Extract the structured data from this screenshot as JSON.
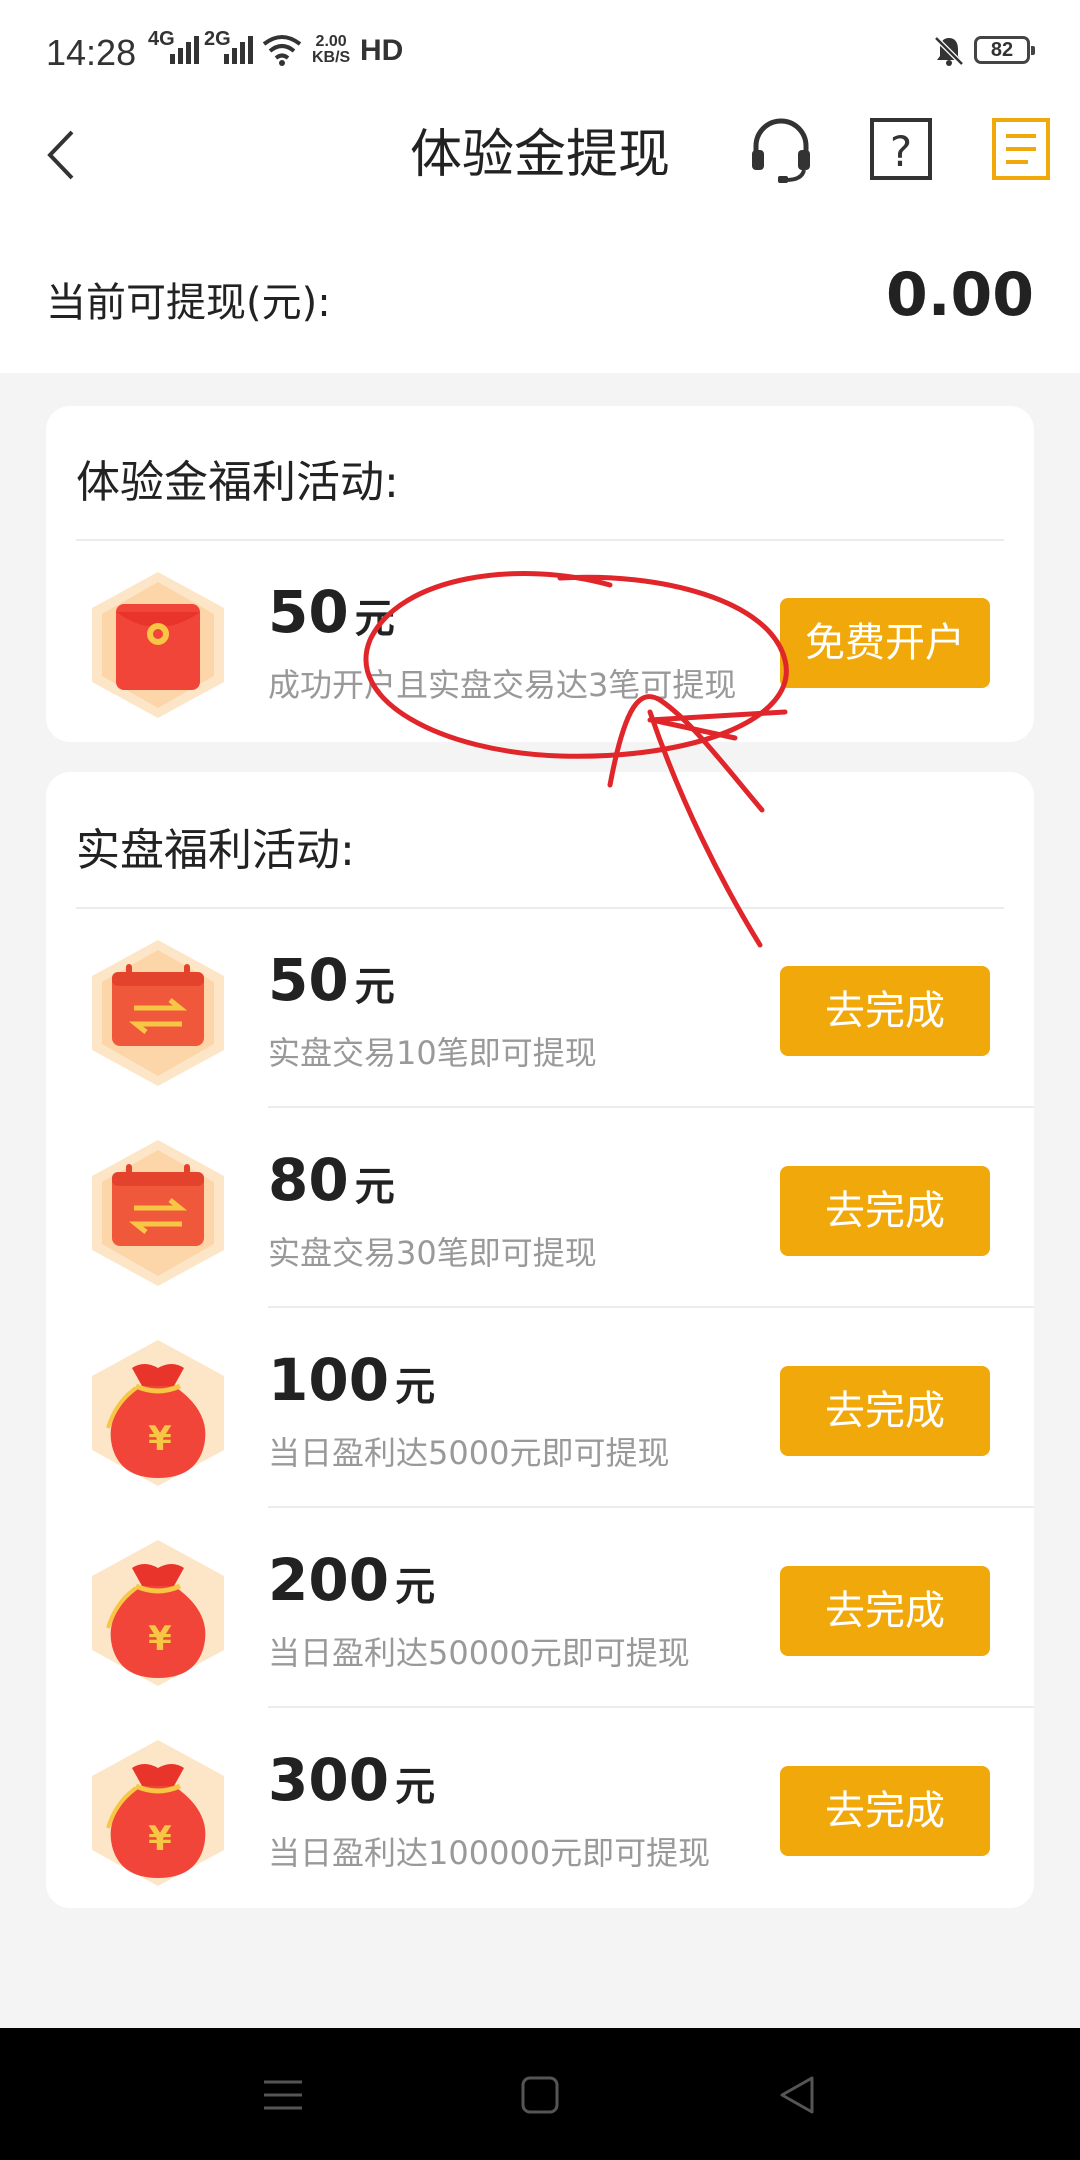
{
  "status_bar": {
    "time": "14:28",
    "net1": "4G",
    "net2": "2G",
    "speed_value": "2.00",
    "speed_unit": "KB/S",
    "hd": "HD",
    "battery": "82"
  },
  "header": {
    "title": "体验金提现",
    "back_icon": "back-arrow-icon",
    "support_icon": "headset-icon",
    "help_icon": "help-icon",
    "records_icon": "document-list-icon",
    "records_icon_color": "#f0a80a"
  },
  "balance": {
    "label": "当前可提现(元):",
    "value": "0.00"
  },
  "trial_section": {
    "title": "体验金福利活动:",
    "items": [
      {
        "amount": "50",
        "unit": "元",
        "desc": "成功开户且实盘交易达3笔可提现",
        "button": "免费开户",
        "icon": "red-envelope-icon"
      }
    ]
  },
  "real_section": {
    "title": "实盘福利活动:",
    "items": [
      {
        "amount": "50",
        "unit": "元",
        "desc": "实盘交易10笔即可提现",
        "button": "去完成",
        "icon": "trade-exchange-icon"
      },
      {
        "amount": "80",
        "unit": "元",
        "desc": "实盘交易30笔即可提现",
        "button": "去完成",
        "icon": "trade-exchange-icon"
      },
      {
        "amount": "100",
        "unit": "元",
        "desc": "当日盈利达5000元即可提现",
        "button": "去完成",
        "icon": "money-bag-icon"
      },
      {
        "amount": "200",
        "unit": "元",
        "desc": "当日盈利达50000元即可提现",
        "button": "去完成",
        "icon": "money-bag-icon"
      },
      {
        "amount": "300",
        "unit": "元",
        "desc": "当日盈利达100000元即可提现",
        "button": "去完成",
        "icon": "money-bag-icon"
      }
    ]
  },
  "colors": {
    "accent": "#f0a80a",
    "annotation": "#e0262a"
  },
  "system_nav": {
    "menu_icon": "menu-icon",
    "home_icon": "home-icon",
    "back_icon": "back-triangle-icon"
  }
}
